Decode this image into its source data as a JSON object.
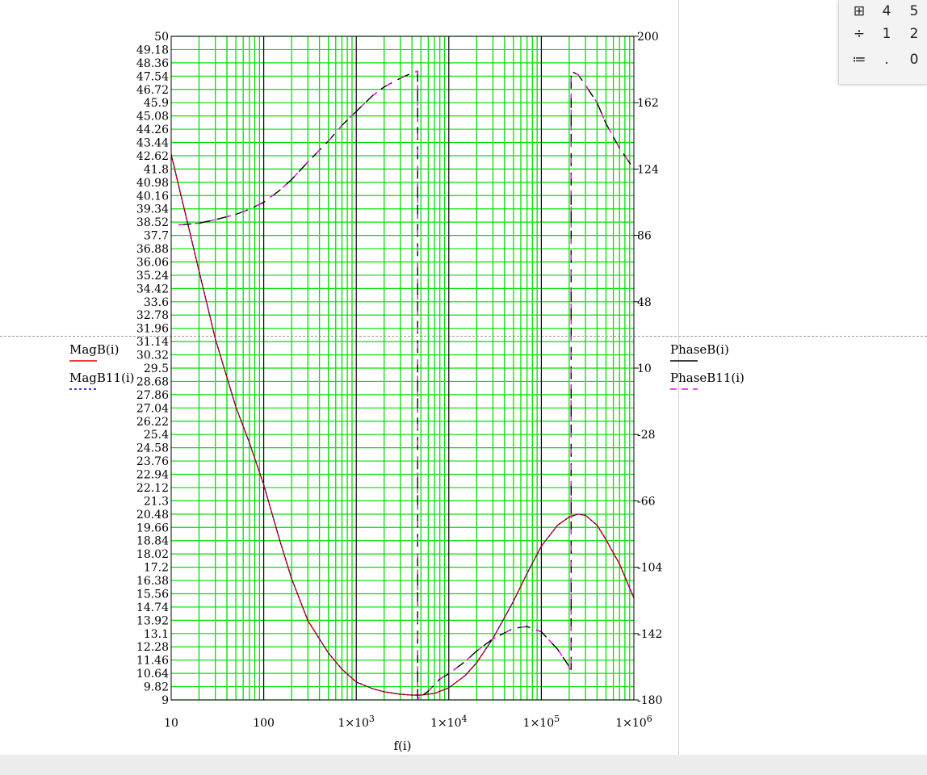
{
  "palette": {
    "rows": [
      [
        "⊞",
        "4",
        "5"
      ],
      [
        "÷",
        "1",
        "2"
      ],
      [
        "≔",
        ".",
        "0"
      ]
    ]
  },
  "legend": {
    "left": [
      {
        "label": "MagB(i)",
        "color": "#e00000",
        "style": "solid"
      },
      {
        "label": "MagB11(i)",
        "color": "#0000c0",
        "style": "dotted"
      }
    ],
    "right": [
      {
        "label": "PhaseB(i)",
        "color": "#000000",
        "style": "solid"
      },
      {
        "label": "PhaseB11(i)",
        "color": "#ff00ff",
        "style": "dashed"
      }
    ]
  },
  "colors": {
    "grid_minor": "#00e000",
    "grid_major": "#000000",
    "mag": "#e00000",
    "mag11": "#0000c0",
    "phase": "#000000",
    "phase11": "#ff00ff"
  },
  "chart_data": {
    "type": "line",
    "xlabel": "f(i)",
    "x_scale": "log",
    "xlim": [
      10,
      1000000
    ],
    "x_ticks": [
      {
        "value": 10,
        "label": "10"
      },
      {
        "value": 100,
        "label": "100"
      },
      {
        "value": 1000,
        "label": "1×10",
        "exp": "3"
      },
      {
        "value": 10000,
        "label": "1×10",
        "exp": "4"
      },
      {
        "value": 100000,
        "label": "1×10",
        "exp": "5"
      },
      {
        "value": 1000000,
        "label": "1×10",
        "exp": "6"
      }
    ],
    "ylim_left": [
      9,
      50
    ],
    "y_left_ticks": [
      "50",
      "49.18",
      "48.36",
      "47.54",
      "46.72",
      "45.9",
      "45.08",
      "44.26",
      "43.44",
      "42.62",
      "41.8",
      "40.98",
      "40.16",
      "39.34",
      "38.52",
      "37.7",
      "36.88",
      "36.06",
      "35.24",
      "34.42",
      "33.6",
      "32.78",
      "31.96",
      "31.14",
      "30.32",
      "29.5",
      "28.68",
      "27.86",
      "27.04",
      "26.22",
      "25.4",
      "24.58",
      "23.76",
      "22.94",
      "22.12",
      "21.3",
      "20.48",
      "19.66",
      "18.84",
      "18.02",
      "17.2",
      "16.38",
      "15.56",
      "14.74",
      "13.92",
      "13.1",
      "12.28",
      "11.46",
      "10.64",
      "9.82",
      "9"
    ],
    "ylim_right": [
      -180,
      200
    ],
    "y_right_ticks": [
      "200",
      "162",
      "124",
      "86",
      "48",
      "10",
      "-28",
      "-66",
      "-104",
      "-142",
      "-180"
    ],
    "series": [
      {
        "name": "MagB(i)",
        "axis": "left",
        "x": [
          10,
          15,
          20,
          30,
          50,
          70,
          100,
          150,
          200,
          300,
          500,
          700,
          1000,
          1500,
          2000,
          3000,
          4000,
          5000,
          7000,
          10000,
          15000,
          20000,
          30000,
          50000,
          70000,
          100000,
          150000,
          200000,
          250000,
          300000,
          400000,
          500000,
          700000,
          1000000
        ],
        "y": [
          42.7,
          38.5,
          35.5,
          31.3,
          27.1,
          24.9,
          22.3,
          18.8,
          16.5,
          13.9,
          11.9,
          10.9,
          10.1,
          9.7,
          9.5,
          9.35,
          9.3,
          9.3,
          9.4,
          9.75,
          10.5,
          11.3,
          12.8,
          15.1,
          16.8,
          18.5,
          19.8,
          20.3,
          20.48,
          20.4,
          19.8,
          18.9,
          17.4,
          15.3
        ]
      },
      {
        "name": "MagB11(i)",
        "axis": "left",
        "x": [
          10,
          15,
          20,
          30,
          50,
          70,
          100,
          150,
          200,
          300,
          500,
          700,
          1000,
          1500,
          2000,
          3000,
          4000,
          5000,
          7000,
          10000,
          15000,
          20000,
          30000,
          50000,
          70000,
          100000,
          150000,
          200000,
          250000,
          300000,
          400000,
          500000,
          700000,
          1000000
        ],
        "y": [
          42.7,
          38.5,
          35.5,
          31.3,
          27.1,
          24.9,
          22.3,
          18.8,
          16.5,
          13.9,
          11.9,
          10.9,
          10.1,
          9.7,
          9.5,
          9.35,
          9.3,
          9.3,
          9.4,
          9.75,
          10.5,
          11.3,
          12.8,
          15.1,
          16.8,
          18.5,
          19.8,
          20.3,
          20.48,
          20.4,
          19.8,
          18.9,
          17.4,
          15.3
        ]
      },
      {
        "name": "PhaseB(i)",
        "axis": "right",
        "x": [
          12,
          20,
          30,
          50,
          70,
          100,
          150,
          200,
          300,
          500,
          700,
          1000,
          1500,
          2000,
          3000,
          4000,
          4600,
          4600,
          4700,
          6000,
          8000,
          10000,
          15000,
          20000,
          30000,
          50000,
          70000,
          100000,
          150000,
          195000,
          210000,
          210000,
          250000,
          300000,
          400000,
          500000,
          700000,
          1000000
        ],
        "y": [
          92,
          93,
          95,
          98,
          101,
          105,
          112,
          118,
          128,
          140,
          149,
          157,
          166,
          171,
          176,
          179,
          180,
          -180,
          -179,
          -175,
          -168,
          -165,
          -158,
          -152,
          -145,
          -139,
          -138,
          -141,
          -151,
          -160,
          -164,
          180,
          178,
          172,
          162,
          150,
          136,
          124
        ]
      },
      {
        "name": "PhaseB11(i)",
        "axis": "right",
        "x": [
          12,
          20,
          30,
          50,
          70,
          100,
          150,
          200,
          300,
          500,
          700,
          1000,
          1500,
          2000,
          3000,
          4000,
          4600,
          4600,
          4700,
          6000,
          8000,
          10000,
          15000,
          20000,
          30000,
          50000,
          70000,
          100000,
          150000,
          195000,
          210000,
          210000,
          250000,
          300000,
          400000,
          500000,
          700000,
          1000000
        ],
        "y": [
          92,
          93,
          95,
          98,
          101,
          105,
          112,
          118,
          128,
          140,
          149,
          157,
          166,
          171,
          176,
          179,
          180,
          -180,
          -179,
          -175,
          -168,
          -165,
          -158,
          -152,
          -145,
          -139,
          -138,
          -141,
          -151,
          -160,
          -164,
          180,
          178,
          172,
          162,
          150,
          136,
          124
        ]
      }
    ]
  }
}
